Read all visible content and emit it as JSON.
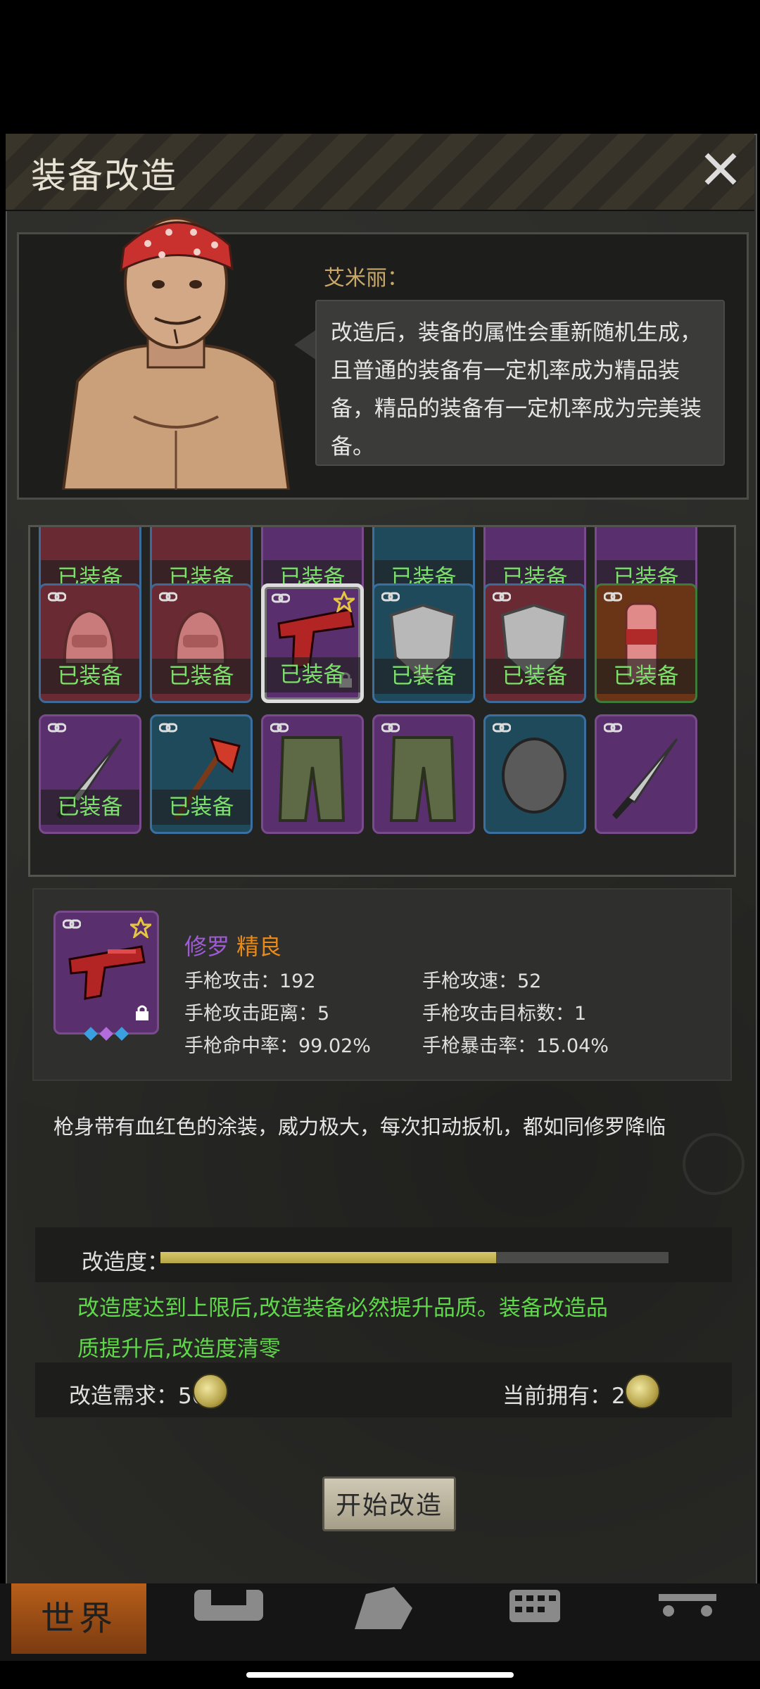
{
  "panel": {
    "title": "装备改造"
  },
  "npc": {
    "name": "艾米丽：",
    "speech": "改造后，装备的属性会重新随机生成，且普通的装备有一定机率成为精品装备，精品的装备有一定机率成为完美装备。"
  },
  "inventory": {
    "equipped_label": "已装备",
    "rows": [
      [
        {
          "type": "partial",
          "color": "red",
          "equipped": true
        },
        {
          "type": "partial",
          "color": "red",
          "equipped": true
        },
        {
          "type": "partial",
          "color": "purple",
          "equipped": true
        },
        {
          "type": "partial",
          "color": "blue",
          "equipped": true
        },
        {
          "type": "partial",
          "color": "purple",
          "equipped": true
        },
        {
          "type": "partial",
          "color": "purple",
          "equipped": true
        }
      ],
      [
        {
          "type": "helmet",
          "color": "red",
          "equipped": true
        },
        {
          "type": "helmet",
          "color": "red",
          "equipped": true
        },
        {
          "type": "pistol",
          "color": "purple",
          "equipped": true,
          "selected": true
        },
        {
          "type": "shield-kite",
          "color": "blue",
          "equipped": true
        },
        {
          "type": "shield-kite",
          "color": "red",
          "equipped": true
        },
        {
          "type": "armguard",
          "color": "orange",
          "equipped": true
        }
      ],
      [
        {
          "type": "knife",
          "color": "purple",
          "equipped": true
        },
        {
          "type": "axe",
          "color": "blue",
          "equipped": true
        },
        {
          "type": "pants",
          "color": "purple",
          "equipped": false
        },
        {
          "type": "pants",
          "color": "purple",
          "equipped": false
        },
        {
          "type": "shield-round",
          "color": "blue",
          "equipped": false
        },
        {
          "type": "knife",
          "color": "purple",
          "equipped": false
        }
      ]
    ]
  },
  "item": {
    "name": "修罗",
    "quality": "精良",
    "stats": {
      "attack": "手枪攻击：192",
      "speed": "手枪攻速：52",
      "range": "手枪攻击距离：5",
      "targets": "手枪攻击目标数：1",
      "accuracy": "手枪命中率：99.02%",
      "crit": "手枪暴击率：15.04%"
    },
    "description": "枪身带有血红色的涂装，威力极大，每次扣动扳机，都如同修罗降临"
  },
  "modification": {
    "label": "改造度：",
    "progress": 0.66,
    "note": "改造度达到上限后,改造装备必然提升品质。装备改造品质提升后,改造度清零",
    "requirement": "改造需求：50",
    "owned": "当前拥有：26",
    "start_button": "开始改造"
  },
  "nav": {
    "world": "世界"
  },
  "colors": {
    "accent_green": "#5fd84a",
    "quality_orange": "#e88a1a",
    "name_purple": "#a05bd8"
  }
}
